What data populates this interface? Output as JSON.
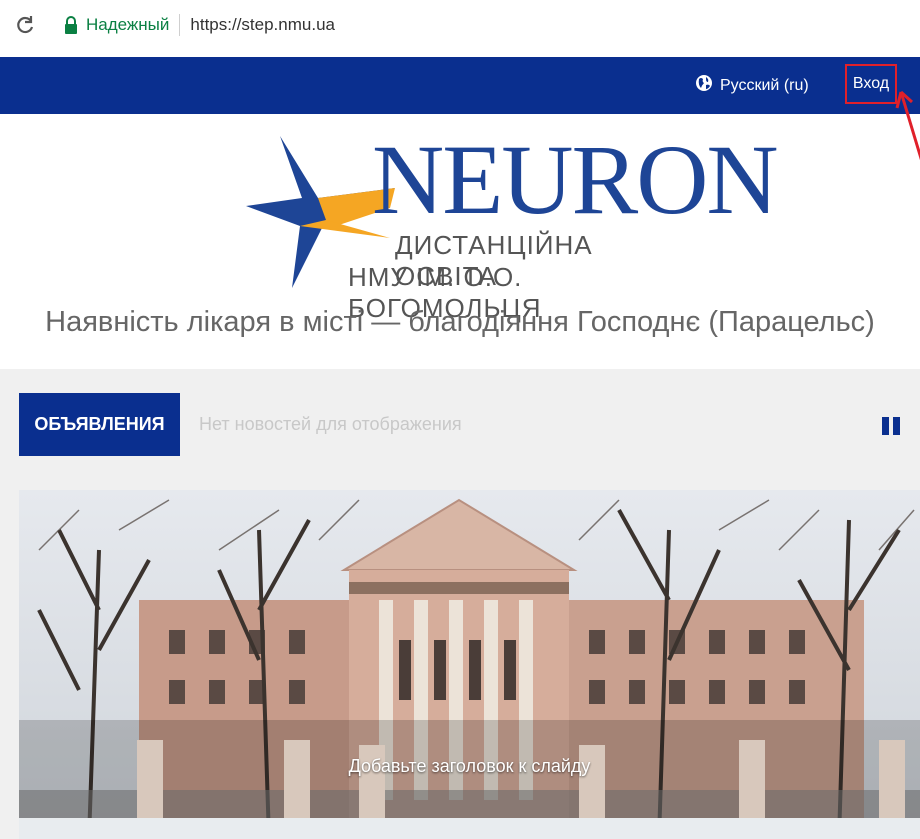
{
  "browser": {
    "secure_label": "Надежный",
    "url": "https://step.nmu.ua"
  },
  "topnav": {
    "language": "Русский (ru)",
    "login": "Вход"
  },
  "logo": {
    "word": "NEURON",
    "line1": "ДИСТАНЦІЙНА ОСВІТА",
    "line2": "НМУ ІМ. О.О. БОГОМОЛЬЦЯ"
  },
  "motto": "Наявність лікаря в місті — благодіяння Господнє (Парацельс)",
  "announcements": {
    "tag": "ОБЪЯВЛЕНИЯ",
    "message": "Нет новостей для отображения"
  },
  "slider": {
    "caption": "Добавьте заголовок к слайду"
  },
  "colors": {
    "navy": "#0a2f8f",
    "logo_blue": "#1e4596",
    "logo_orange": "#f5a623",
    "annotation_red": "#e0202a"
  }
}
